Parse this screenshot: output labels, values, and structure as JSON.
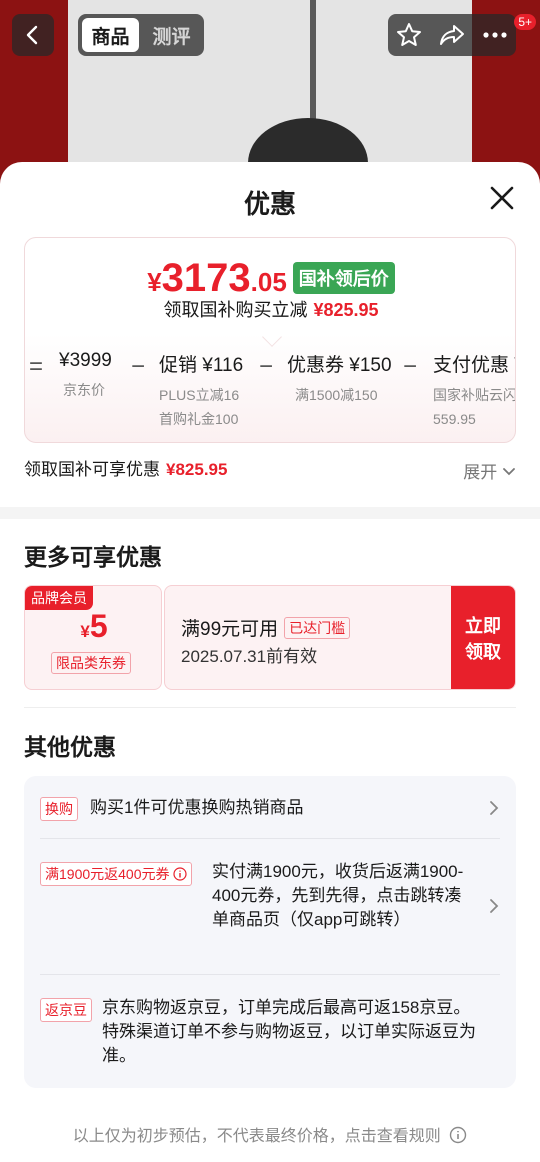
{
  "nav": {
    "tabs": [
      "商品",
      "测评"
    ],
    "active_tab": "商品",
    "notification_badge": "5+"
  },
  "sheet": {
    "title": "优惠",
    "final_price": {
      "symbol": "¥",
      "integer": "3173",
      "decimal": ".05"
    },
    "final_price_tag": "国补领后价",
    "saving_text": "领取国补购买立减",
    "saving_amount": "¥825.95",
    "breakdown": [
      {
        "operator": "=",
        "amount": "¥3999",
        "label": "京东价",
        "sub": ""
      },
      {
        "operator": "−",
        "amount": "促销 ¥116",
        "label": "PLUS立减16",
        "sub": "首购礼金100"
      },
      {
        "operator": "−",
        "amount": "优惠券 ¥150",
        "label": "满1500减150",
        "sub": ""
      },
      {
        "operator": "−",
        "amount": "支付优惠 ¥",
        "label": "国家补贴云闪",
        "sub": "559.95"
      }
    ],
    "claim_text": "领取国补可享优惠",
    "claim_amount": "¥825.95",
    "expand_label": "展开"
  },
  "more_offers": {
    "title": "更多可享优惠",
    "coupon": {
      "tag": "品牌会员",
      "symbol": "¥",
      "amount": "5",
      "type": "限品类东券",
      "condition": "满99元可用",
      "reached_tag": "已达门槛",
      "validity": "2025.07.31前有效",
      "button_line1": "立即",
      "button_line2": "领取"
    }
  },
  "other_offers": {
    "title": "其他优惠",
    "items": [
      {
        "tag": "换购",
        "text": "购买1件可优惠换购热销商品",
        "chevron": true
      },
      {
        "tag": "满1900元返400元券",
        "text": "实付满1900元，收货后返满1900-400元券，先到先得，点击跳转凑单商品页（仅app可跳转）",
        "chevron": true
      },
      {
        "tag": "返京豆",
        "text": "京东购物返京豆，订单完成后最高可返158京豆。特殊渠道订单不参与购物返豆，以订单实际返豆为准。",
        "chevron": false
      }
    ]
  },
  "footer": {
    "text": "以上仅为初步预估，不代表最终价格，点击查看规则"
  },
  "colors": {
    "accent_red": "#e8202b",
    "tag_green": "#3aa655",
    "muted": "#8a8a8a"
  }
}
